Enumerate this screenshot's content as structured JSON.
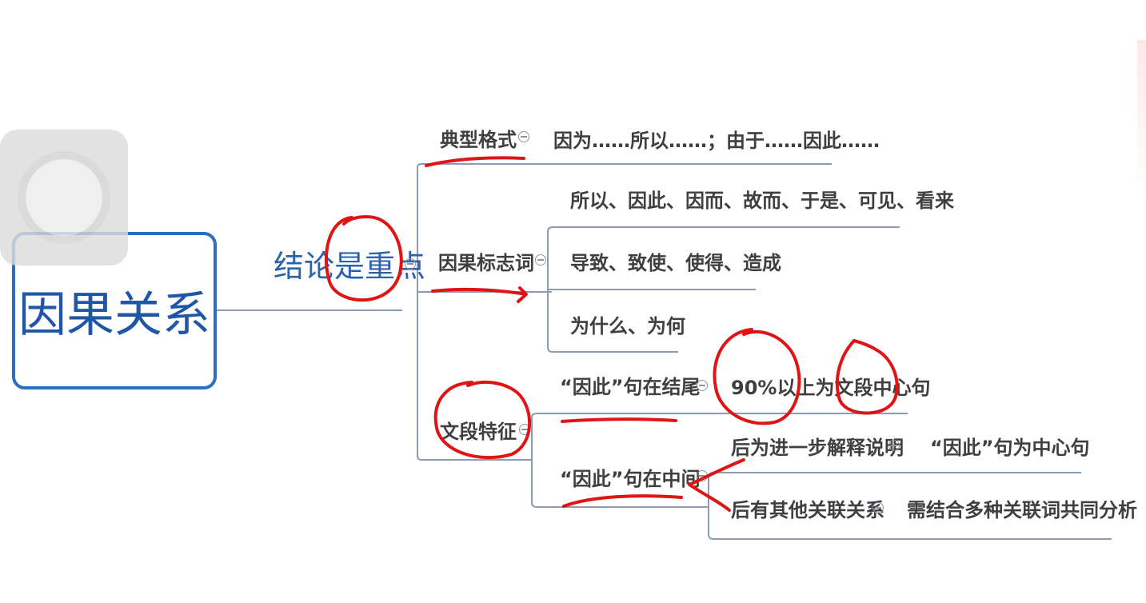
{
  "root": {
    "label": "因果关系"
  },
  "branch": {
    "label": "结论是重点"
  },
  "groups": {
    "format": {
      "label": "典型格式",
      "text": "因为……所以……；由于……因此……"
    },
    "markers": {
      "label": "因果标志词",
      "items": [
        "所以、因此、因而、故而、于是、可见、看来",
        "导致、致使、使得、造成",
        "为什么、为何"
      ]
    },
    "paragraph": {
      "label": "文段特征",
      "end": {
        "label": "“因此”句在结尾",
        "result": "90%以上为文段中心句"
      },
      "middle": {
        "label": "“因此”句在中间",
        "cases": [
          {
            "label": "后为进一步解释说明",
            "result": "“因此”句为中心句"
          },
          {
            "label": "后有其他关联关系",
            "result": "需结合多种关联词共同分析"
          }
        ]
      }
    }
  },
  "colors": {
    "line": "#8c9cb8",
    "root_border": "#2e6ec1",
    "root_text": "#1f56a6",
    "annotation": "#e01414"
  },
  "icons": {
    "collapse": "minus-circle-icon",
    "overlay": "floating-button-icon"
  }
}
